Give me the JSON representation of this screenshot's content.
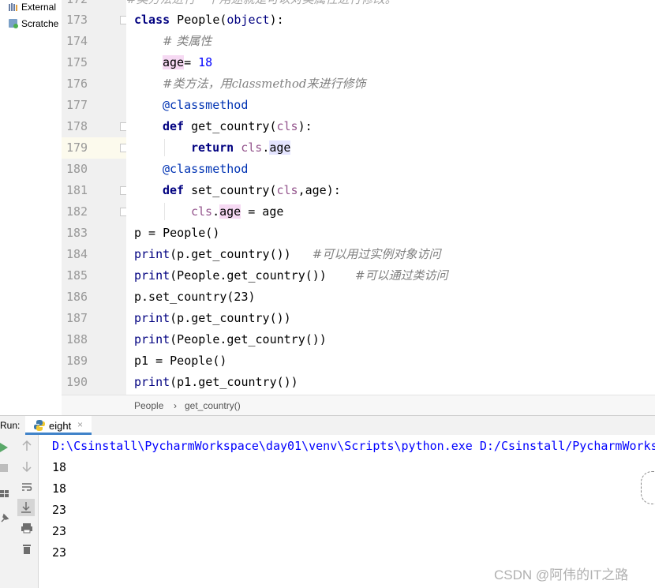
{
  "project_panel": {
    "items": [
      "External",
      "Scratche"
    ]
  },
  "editor": {
    "lines": [
      {
        "num": "172",
        "text": "#类方法进行一下用途就是可以对类属性进行修改。"
      },
      {
        "num": "173"
      },
      {
        "num": "174"
      },
      {
        "num": "175"
      },
      {
        "num": "176"
      },
      {
        "num": "177"
      },
      {
        "num": "178"
      },
      {
        "num": "179"
      },
      {
        "num": "180"
      },
      {
        "num": "181"
      },
      {
        "num": "182"
      },
      {
        "num": "183"
      },
      {
        "num": "184"
      },
      {
        "num": "185"
      },
      {
        "num": "186"
      },
      {
        "num": "187"
      },
      {
        "num": "188"
      },
      {
        "num": "189"
      },
      {
        "num": "190"
      }
    ],
    "code": {
      "l173_kw": "class",
      "l173_rest": " People(",
      "l173_obj": "object",
      "l173_end": "):",
      "l174_comment": "# 类属性",
      "l175_age": "age",
      "l175_eq": "= ",
      "l175_val": "18",
      "l176_comment": "#类方法，用classmethod来进行修饰",
      "l177_dec": "@classmethod",
      "l178_def": "def",
      "l178_name": " get_country(",
      "l178_cls": "cls",
      "l178_end": "):",
      "l179_ret": "return",
      "l179_cls": " cls",
      "l179_dot": ".",
      "l179_age": "age",
      "l180_dec": "@classmethod",
      "l181_def": "def",
      "l181_name": " set_country(",
      "l181_cls": "cls",
      "l181_end": ",age):",
      "l182_cls": "cls",
      "l182_dot": ".",
      "l182_age": "age",
      "l182_rest": " = age",
      "l183": "p = People()",
      "l184_fn": "print",
      "l184_rest": "(p.get_country())   ",
      "l184_comment": "#可以用过实例对象访问",
      "l185_fn": "print",
      "l185_rest": "(People.get_country())    ",
      "l185_comment": "#可以通过类访问",
      "l186": "p.set_country(23)",
      "l187_fn": "print",
      "l187_rest": "(p.get_country())",
      "l188_fn": "print",
      "l188_rest": "(People.get_country())",
      "l189": "p1 = People()",
      "l190_fn": "print",
      "l190_rest": "(p1.get_country())"
    }
  },
  "breadcrumb": {
    "class_name": "People",
    "separator": "›",
    "method": "get_country()"
  },
  "run": {
    "label": "Run:",
    "tab_name": "eight",
    "tab_close": "×"
  },
  "console": {
    "command": "D:\\Csinstall\\PycharmWorkspace\\day01\\venv\\Scripts\\python.exe D:/Csinstall/PycharmWorks",
    "outputs": [
      "18",
      "18",
      "23",
      "23",
      "23"
    ]
  },
  "watermark": "CSDN @阿伟的IT之路",
  "colors": {
    "keyword": "#000080",
    "comment": "#808080",
    "number": "#0000ff",
    "self": "#94558d",
    "caret_row": "#fcfaed",
    "tab_underline": "#4083c9"
  }
}
